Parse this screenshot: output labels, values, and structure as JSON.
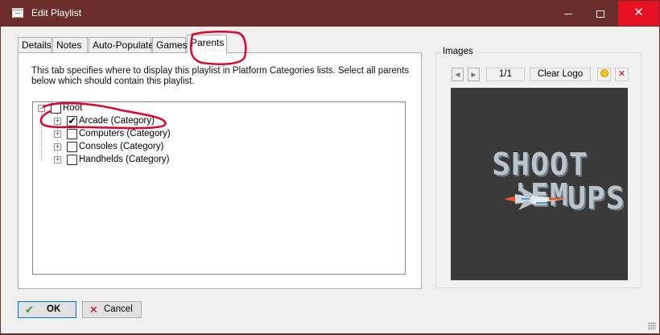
{
  "window": {
    "title": "Edit Playlist"
  },
  "tabs": [
    {
      "label": "Details"
    },
    {
      "label": "Notes"
    },
    {
      "label": "Auto-Populate"
    },
    {
      "label": "Games"
    },
    {
      "label": "Parents",
      "active": true
    }
  ],
  "parents_tab": {
    "description": "This tab specifies where to display this playlist in Platform Categories lists. Select all parents below which should contain this playlist.",
    "tree": {
      "root": {
        "label": "Root",
        "checked": false
      },
      "children": [
        {
          "label": "Arcade (Category)",
          "checked": true
        },
        {
          "label": "Computers (Category)",
          "checked": false
        },
        {
          "label": "Consoles (Category)",
          "checked": false
        },
        {
          "label": "Handhelds (Category)",
          "checked": false
        }
      ]
    }
  },
  "images": {
    "group_title": "Images",
    "counter": "1/1",
    "clear_label": "Clear Logo",
    "logo_text_line1": "SHOOT 'EM",
    "logo_text_line2": "UPS"
  },
  "footer": {
    "ok_label": "OK",
    "cancel_label": "Cancel"
  },
  "colors": {
    "titlebar": "#6b2e2a",
    "close": "#e81123",
    "annotation": "#e0002a",
    "logo_bg": "#3a3a3a"
  },
  "icons": [
    "window-icon",
    "minimize-icon",
    "maximize-icon",
    "close-icon",
    "prev-arrow-icon",
    "next-arrow-icon",
    "add-image-icon",
    "delete-image-icon",
    "checkmark-icon",
    "cancel-x-icon"
  ]
}
